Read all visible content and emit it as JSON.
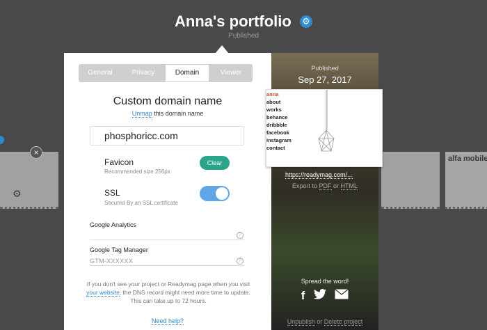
{
  "header": {
    "title": "Anna's portfolio",
    "status": "Published"
  },
  "tabs": [
    {
      "label": "General",
      "active": false
    },
    {
      "label": "Privacy",
      "active": false
    },
    {
      "label": "Domain",
      "active": true
    },
    {
      "label": "Viewer",
      "active": false
    }
  ],
  "domain": {
    "heading": "Custom domain name",
    "unmap_link": "Unmap",
    "unmap_rest": "this domain name",
    "value": "phosphoricc.com"
  },
  "favicon": {
    "label": "Favicon",
    "sub": "Recommended size 256px",
    "clear_label": "Clear"
  },
  "ssl": {
    "label": "SSL",
    "sub": "Secured By an SSL certificate",
    "enabled": true
  },
  "analytics": {
    "google_analytics_label": "Google Analytics",
    "tag_manager_label": "Google Tag Manager",
    "tag_manager_placeholder": "GTM-XXXXXX"
  },
  "note": {
    "before_link": "If you don't see your project or Readymag page when you visit ",
    "link": "your website",
    "after_link": ", the DNS record might need more time to update. This can take up to 72 hours."
  },
  "need_help": "Need help?",
  "publish_info": {
    "label": "Published",
    "date": "Sep 27, 2017",
    "url": "https://readymag.com/...",
    "export_prefix": "Export to",
    "export_pdf": "PDF",
    "export_or": "or",
    "export_html": "HTML",
    "spread": "Spread the word!",
    "unpublish": "Unpublish",
    "unpub_or": "or",
    "delete": "Delete project"
  },
  "preview_menu": [
    "anna",
    "about",
    "works",
    "behance",
    "dribbble",
    "facebook",
    "instagram",
    "contact"
  ],
  "background": {
    "thumb_right_text": "alfa mobile"
  },
  "colors": {
    "accent_blue": "#2b86c9",
    "clear_green": "#2aa58a",
    "toggle_blue": "#5ea6e6"
  }
}
